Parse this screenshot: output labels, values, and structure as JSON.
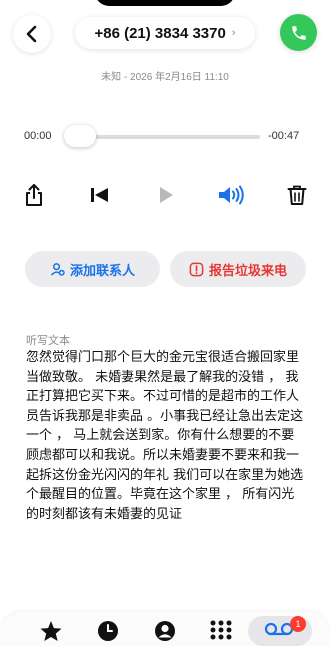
{
  "header": {
    "phone_number": "+86 (21) 3834 3370",
    "chevron": "›",
    "subtitle": "未知 - 2026 年2月16日 11:10"
  },
  "player": {
    "elapsed": "00:00",
    "remaining": "-00:47",
    "progress": 0
  },
  "actions": {
    "add_contact": "添加联系人",
    "report_spam": "报告垃圾来电"
  },
  "transcript": {
    "label": "听写文本",
    "text": "忽然觉得门口那个巨大的金元宝很适合搬回家里当做致敬。 未婚妻果然是最了解我的没错 ， 我正打算把它买下来。不过可惜的是超市的工作人员告诉我那是非卖品 。小事我已经让急出去定这一个 ， 马上就会送到家。你有什么想要的不要顾虑都可以和我说。所以未婚妻要不要来和我一起拆这份金光闪闪的年礼 我们可以在家里为她选个最醒目的位置。毕竟在这个家里 ， 所有闪光的时刻都该有未婚妻的见证"
  },
  "tabbar": {
    "voicemail_badge": "1",
    "tabs": [
      "favorites-icon",
      "recents-icon",
      "contacts-icon",
      "keypad-icon",
      "voicemail-icon"
    ]
  },
  "colors": {
    "accent_blue": "#1a73e8",
    "danger_red": "#e53935",
    "call_green": "#34c759",
    "badge_red": "#ff3b30"
  }
}
